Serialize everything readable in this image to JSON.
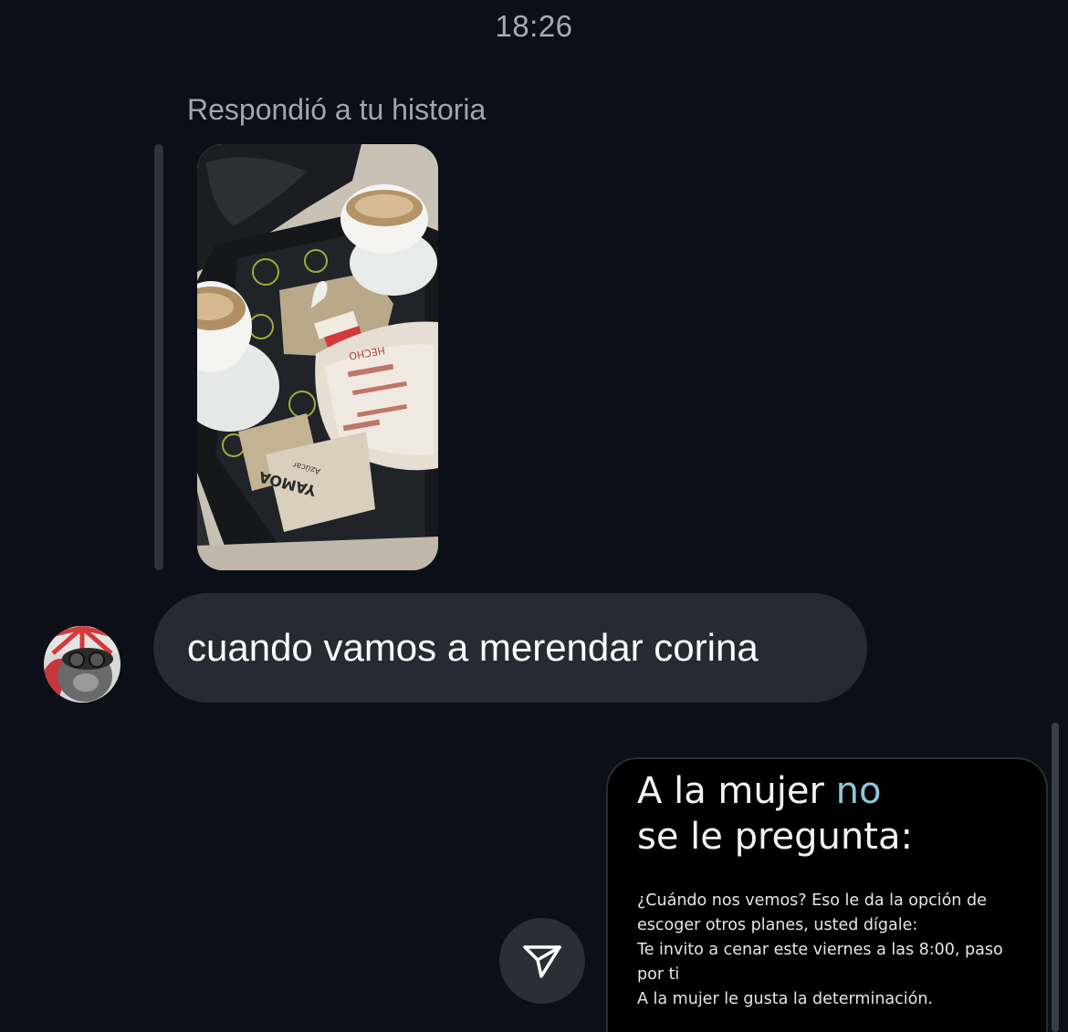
{
  "header": {
    "timestamp": "18:26"
  },
  "story_reply": {
    "label": "Respondió a tu historia",
    "sachet_text": "YAMOA",
    "sachet_subtext": "Azúcar",
    "bag_text": "HECHO"
  },
  "message": {
    "text": "cuando vamos a merendar corina"
  },
  "shared_post": {
    "title_part1": "A la mujer ",
    "title_accent": "no",
    "title_line2": "se le pregunta:",
    "body_lines": [
      "¿Cuándo nos vemos? Eso le da la opción de",
      "escoger otros planes, usted dígale:",
      "Te invito a cenar este viernes a las 8:00, paso",
      "por ti",
      "A la mujer le gusta la determinación."
    ],
    "accent_color": "#8fc7d9"
  },
  "icons": {
    "share": "send-icon",
    "avatar": "cat-helmet-avatar"
  },
  "colors": {
    "background": "#0c0f17",
    "bubble": "#262a33",
    "muted_text": "#a2a5ad"
  }
}
